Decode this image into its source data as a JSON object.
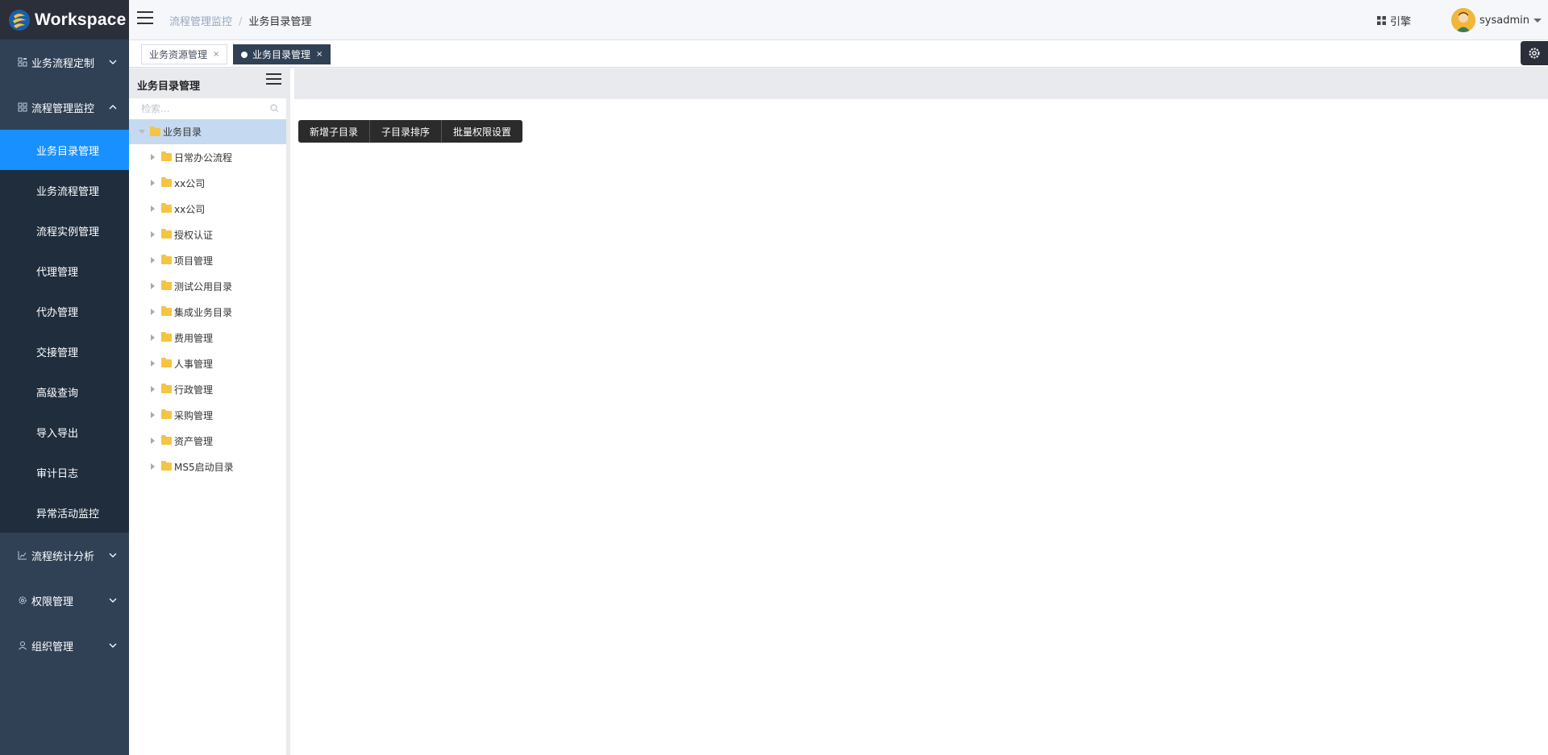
{
  "brand": {
    "name": "Workspace",
    "accent": "#1890ff",
    "sidebar_bg": "#304156"
  },
  "sidebar": {
    "groups": [
      {
        "label": "业务流程定制",
        "icon": "workflow-icon",
        "expanded": false
      },
      {
        "label": "流程管理监控",
        "icon": "grid-icon",
        "expanded": true,
        "items": [
          {
            "label": "业务目录管理",
            "active": true
          },
          {
            "label": "业务流程管理"
          },
          {
            "label": "流程实例管理"
          },
          {
            "label": "代理管理"
          },
          {
            "label": "代办管理"
          },
          {
            "label": "交接管理"
          },
          {
            "label": "高级查询"
          },
          {
            "label": "导入导出"
          },
          {
            "label": "审计日志"
          },
          {
            "label": "异常活动监控"
          }
        ]
      },
      {
        "label": "流程统计分析",
        "icon": "chart-icon",
        "expanded": false
      },
      {
        "label": "权限管理",
        "icon": "gear-icon",
        "expanded": false
      },
      {
        "label": "组织管理",
        "icon": "user-icon",
        "expanded": false
      }
    ]
  },
  "header": {
    "breadcrumb": [
      "流程管理监控",
      "业务目录管理"
    ],
    "breadcrumb_sep": "/",
    "engine_label": "引擎",
    "user_name": "sysadmin"
  },
  "tabs": [
    {
      "label": "业务资源管理",
      "close": "×",
      "active": false
    },
    {
      "label": "业务目录管理",
      "close": "×",
      "active": true
    }
  ],
  "tree": {
    "title": "业务目录管理",
    "search_placeholder": "检索...",
    "root": "业务目录",
    "nodes": [
      "日常办公流程",
      "xx公司",
      "xx公司",
      "授权认证",
      "项目管理",
      "测试公用目录",
      "集成业务目录",
      "费用管理",
      "人事管理",
      "行政管理",
      "采购管理",
      "资产管理",
      "MS5启动目录"
    ]
  },
  "toolbar": {
    "buttons": [
      "新增子目录",
      "子目录排序",
      "批量权限设置"
    ]
  }
}
